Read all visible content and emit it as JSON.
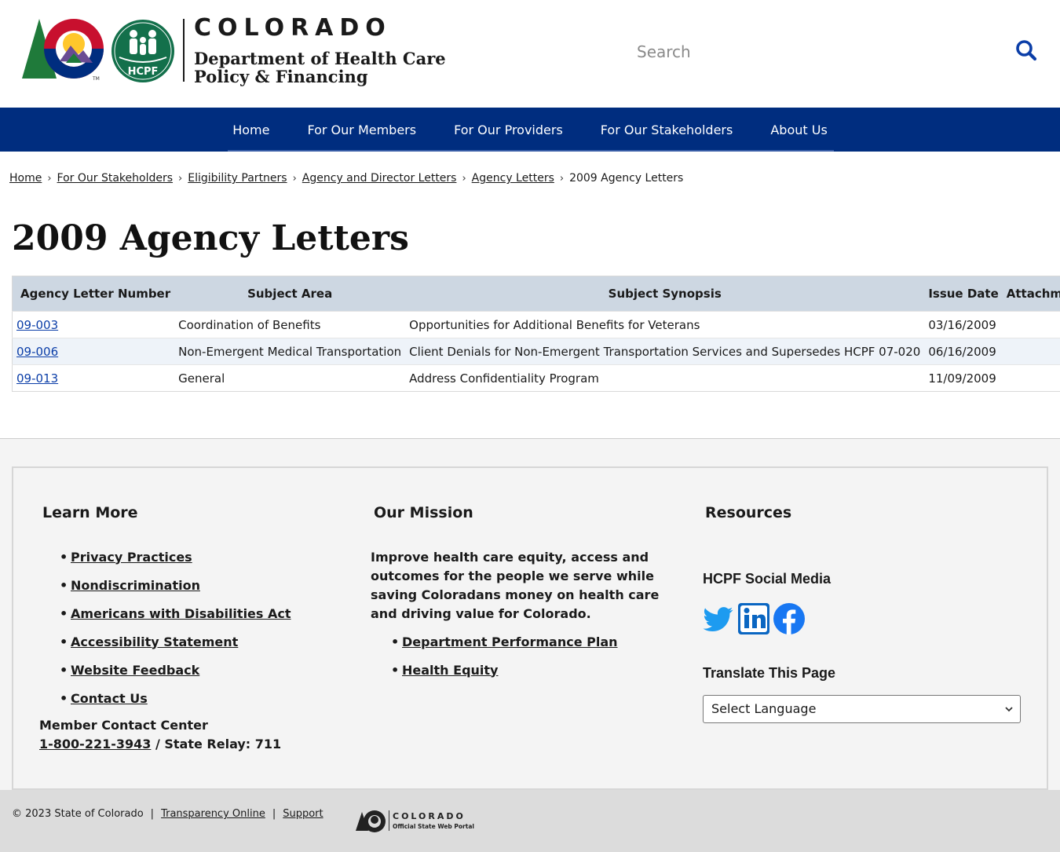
{
  "header": {
    "state_name": "COLORADO",
    "dept_line1": "Department of Health Care",
    "dept_line2": "Policy & Financing",
    "seal_text": "HCPF",
    "tm": "TM",
    "search_placeholder": "Search"
  },
  "nav": {
    "items": [
      "Home",
      "For Our Members",
      "For Our Providers",
      "For Our Stakeholders",
      "About Us"
    ]
  },
  "breadcrumb": {
    "links": [
      "Home",
      "For Our Stakeholders",
      "Eligibility Partners",
      "Agency and Director Letters",
      "Agency Letters"
    ],
    "current": "2009 Agency Letters",
    "separator": "›"
  },
  "page": {
    "title": "2009 Agency Letters"
  },
  "table": {
    "headers": [
      "Agency Letter Number",
      "Subject Area",
      "Subject Synopsis",
      "Issue Date",
      "Attachment"
    ],
    "rows": [
      {
        "number": "09-003",
        "area": "Coordination of Benefits",
        "synopsis": "Opportunities for Additional Benefits for Veterans",
        "date": "03/16/2009",
        "attachment": ""
      },
      {
        "number": "09-006",
        "area": "Non-Emergent Medical Transportation",
        "synopsis": "Client Denials for Non-Emergent Transportation Services and Supersedes HCPF 07-020",
        "date": "06/16/2009",
        "attachment": ""
      },
      {
        "number": "09-013",
        "area": "General",
        "synopsis": "Address Confidentiality Program",
        "date": "11/09/2009",
        "attachment": ""
      }
    ]
  },
  "footer": {
    "learn_more": {
      "heading": "Learn More",
      "links": [
        "Privacy Practices",
        "Nondiscrimination",
        "Americans with Disabilities Act",
        "Accessibility Statement",
        "Website Feedback",
        "Contact Us"
      ]
    },
    "contact": {
      "label": "Member Contact Center",
      "phone": "1-800-221-3943",
      "relay": " / State Relay: 711"
    },
    "mission": {
      "heading": "Our Mission",
      "text": "Improve health care equity, access and outcomes for the people we serve while saving Coloradans money on health care and driving value for Colorado.",
      "links": [
        "Department Performance Plan",
        "Health Equity"
      ]
    },
    "resources": {
      "heading": "Resources",
      "social_heading": "HCPF Social Media",
      "social_icons": [
        "twitter-icon",
        "linkedin-icon",
        "facebook-icon"
      ],
      "translate_heading": "Translate This Page",
      "language_selected": "Select Language"
    }
  },
  "bottom": {
    "copyright": "© 2023 State of Colorado",
    "links": [
      "Transparency Online",
      "Support"
    ],
    "separator": "|",
    "portal_word": "COLORADO",
    "portal_sub": "Official State Web Portal"
  },
  "colors": {
    "nav_bg": "#002d7f",
    "table_header_bg": "#cdd7e2",
    "link_blue": "#0b3ea8",
    "footer_bg": "#f4f4f4",
    "bottom_bar_bg": "#dcdcdc",
    "twitter": "#1d9bf0",
    "linkedin": "#0a66c2",
    "facebook": "#1877f2"
  }
}
